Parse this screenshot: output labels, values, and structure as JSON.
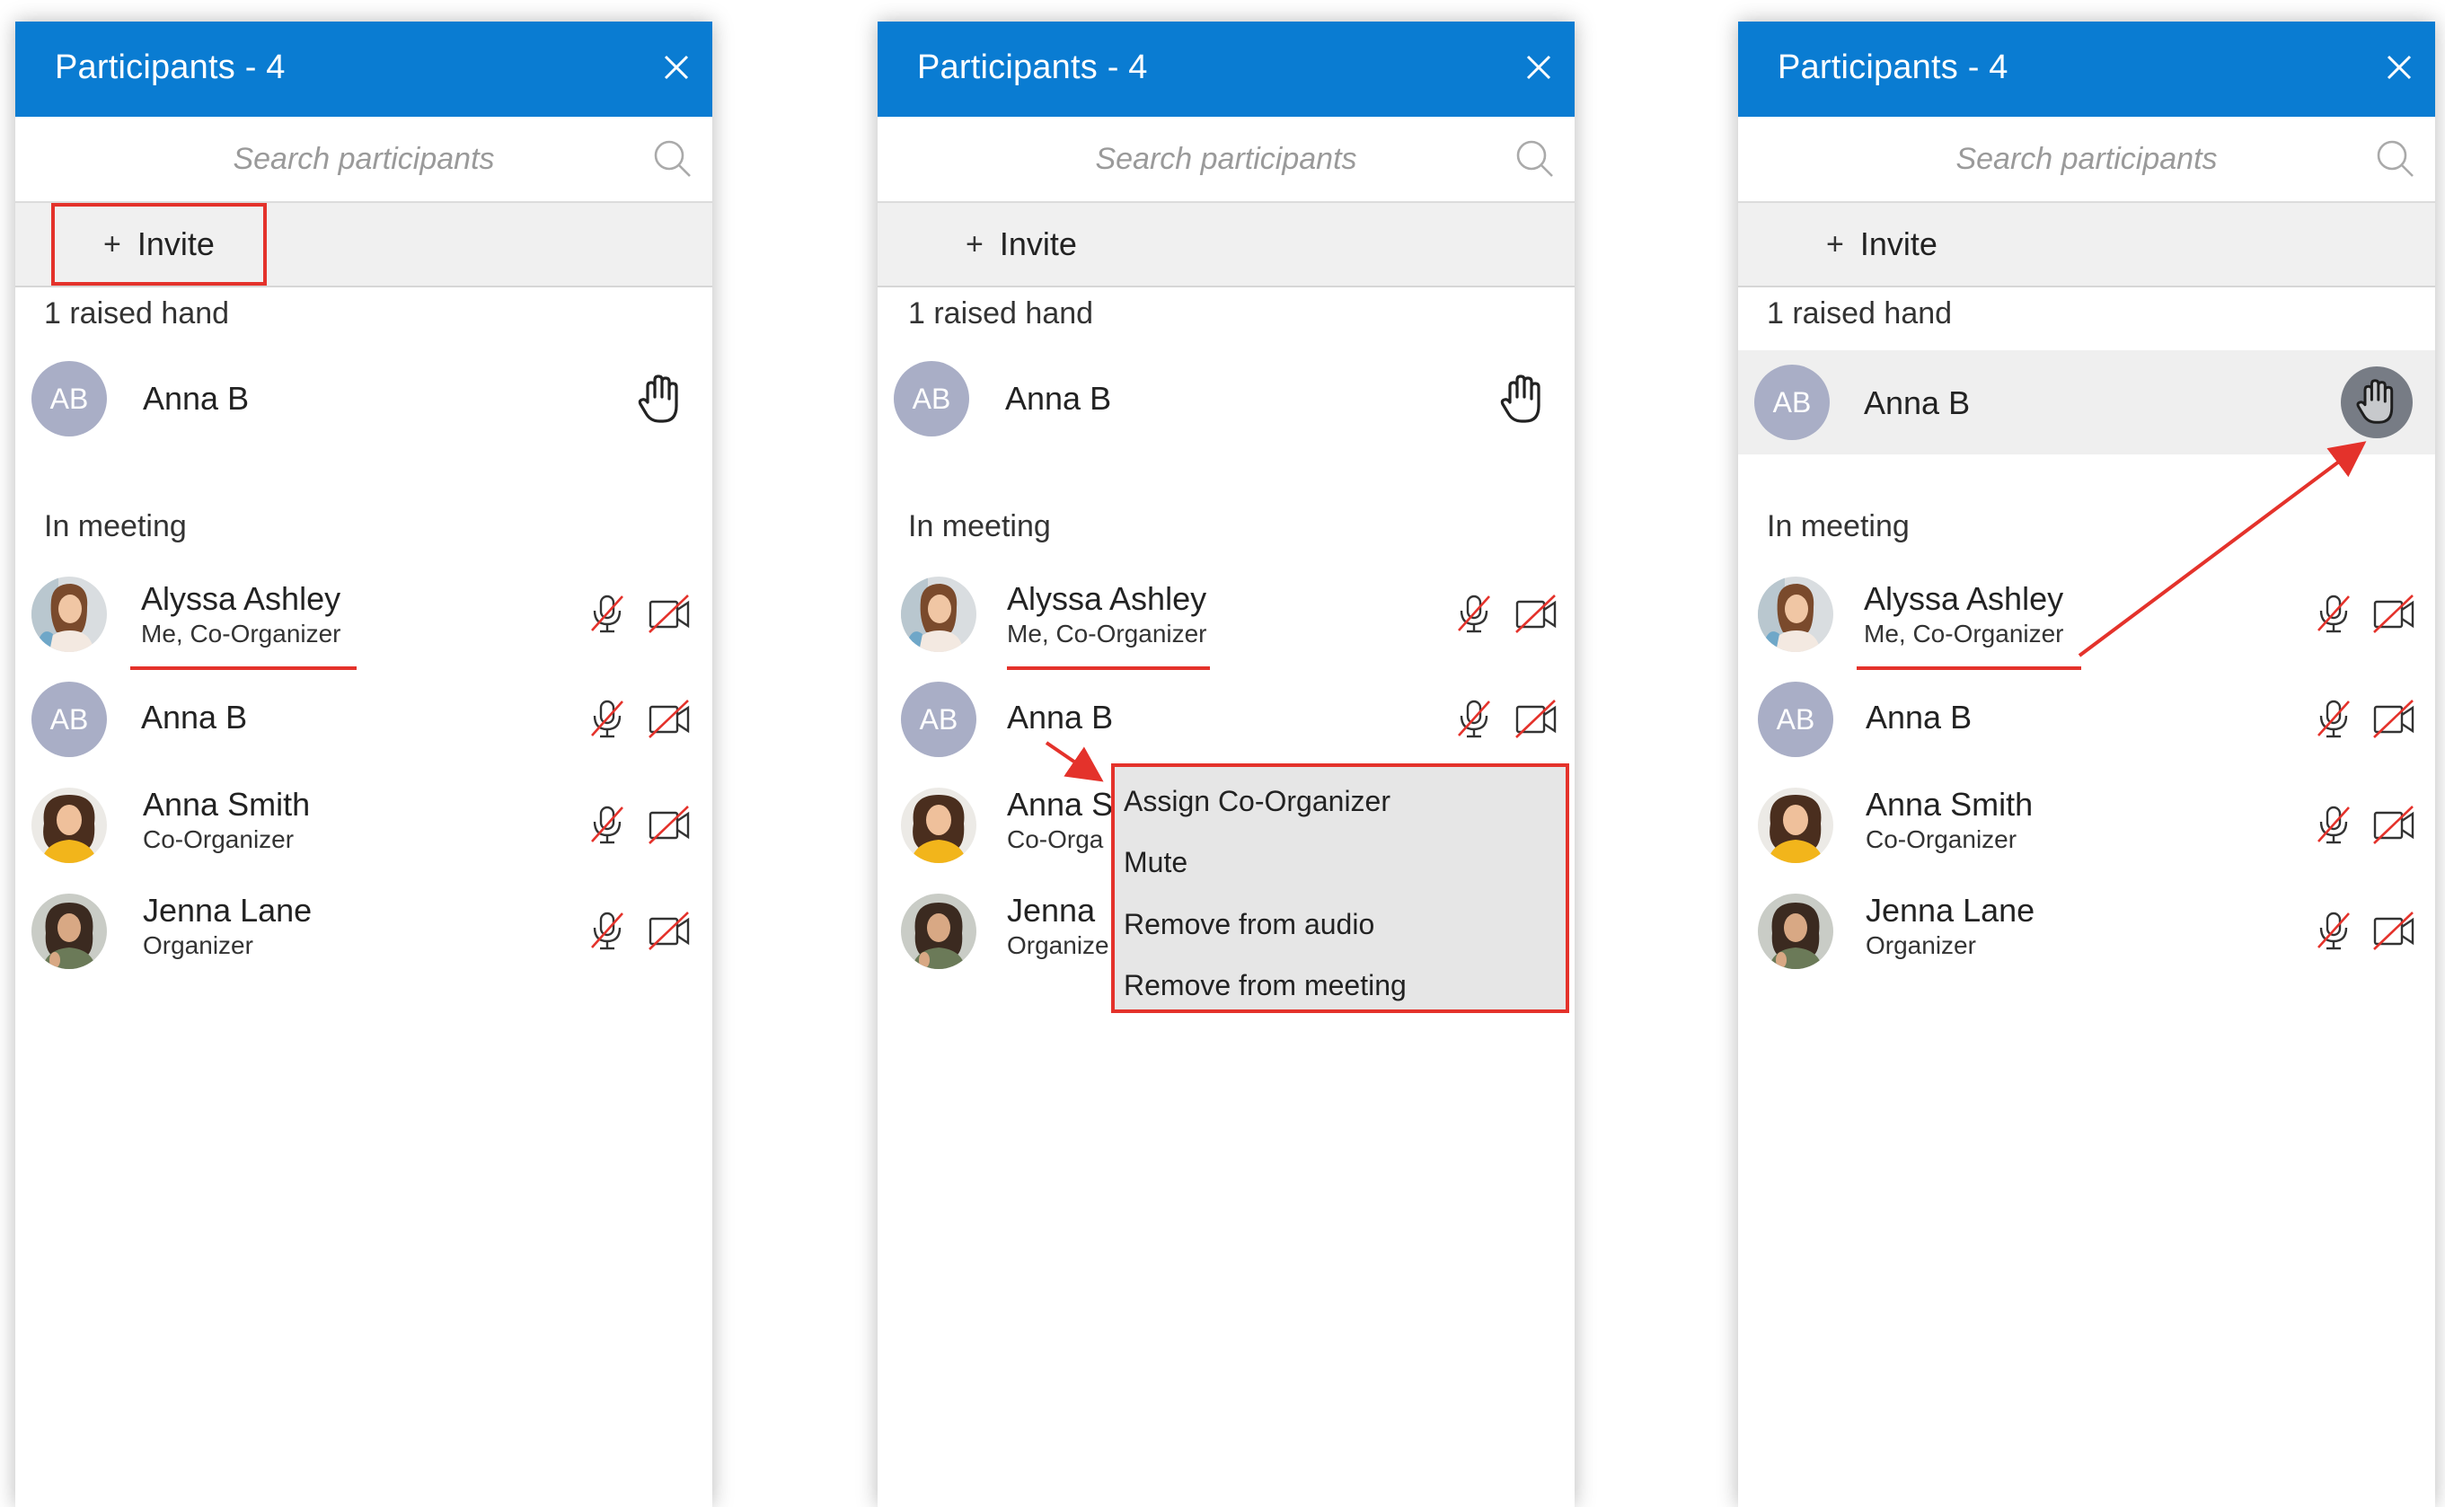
{
  "panels": [
    {
      "header_title": "Participants - 4",
      "search_placeholder": "Search participants",
      "invite_label": "Invite",
      "raised_hand_label": "1 raised hand",
      "in_meeting_label": "In meeting",
      "raised": {
        "initials": "AB",
        "name": "Anna B"
      },
      "participants": [
        {
          "name": "Alyssa Ashley",
          "role": "Me, Co-Organizer"
        },
        {
          "initials": "AB",
          "name": "Anna B",
          "role": ""
        },
        {
          "name": "Anna Smith",
          "role": "Co-Organizer"
        },
        {
          "name": "Jenna Lane",
          "role": "Organizer"
        }
      ]
    },
    {
      "header_title": "Participants - 4",
      "search_placeholder": "Search participants",
      "invite_label": "Invite",
      "raised_hand_label": "1 raised hand",
      "in_meeting_label": "In meeting",
      "raised": {
        "initials": "AB",
        "name": "Anna B"
      },
      "participants": [
        {
          "name": "Alyssa Ashley",
          "role": "Me, Co-Organizer"
        },
        {
          "initials": "AB",
          "name": "Anna B",
          "role": ""
        },
        {
          "name": "Anna S",
          "role": "Co-Orga"
        },
        {
          "name": "Jenna",
          "role": "Organize"
        }
      ],
      "context_menu": [
        "Assign Co-Organizer",
        "Mute",
        "Remove from audio",
        "Remove from meeting"
      ]
    },
    {
      "header_title": "Participants - 4",
      "search_placeholder": "Search participants",
      "invite_label": "Invite",
      "raised_hand_label": "1 raised hand",
      "in_meeting_label": "In meeting",
      "raised": {
        "initials": "AB",
        "name": "Anna B"
      },
      "participants": [
        {
          "name": "Alyssa Ashley",
          "role": "Me, Co-Organizer"
        },
        {
          "initials": "AB",
          "name": "Anna B",
          "role": ""
        },
        {
          "name": "Anna Smith",
          "role": "Co-Organizer"
        },
        {
          "name": "Jenna Lane",
          "role": "Organizer"
        }
      ]
    }
  ],
  "colors": {
    "header": "#0a7cd2",
    "highlight": "#e4322b",
    "avatar_initials_bg": "#a9aec6",
    "hand_active_bg": "#777c85"
  },
  "icons": {
    "close": "close-icon",
    "search": "search-icon",
    "hand": "raised-hand-icon",
    "mic": "mic-muted-icon",
    "camera": "camera-off-icon"
  }
}
